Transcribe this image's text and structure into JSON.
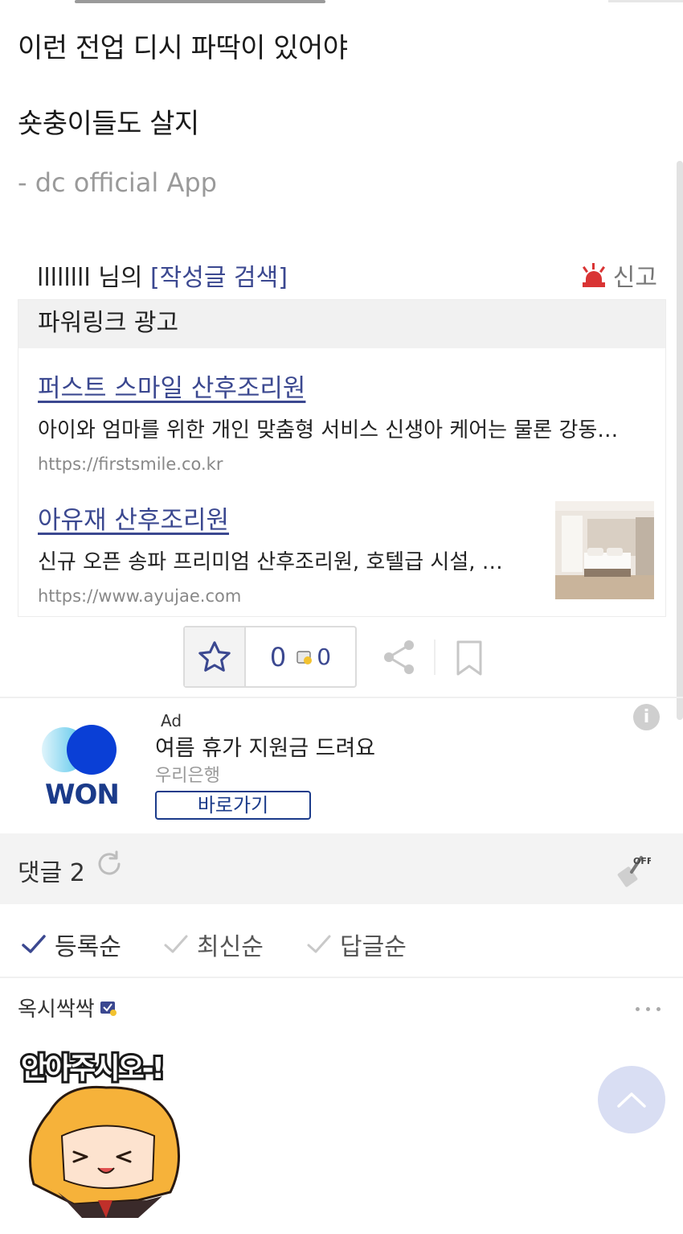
{
  "post": {
    "line1": "이런 전업 디시 파딱이 있어야",
    "line2": "숏충이들도 살지",
    "signature": "- dc official App"
  },
  "author": {
    "nickname": "llllllll 님의",
    "search_link": "[작성글 검색]",
    "report_label": "신고"
  },
  "powerlink": {
    "header": "파워링크 광고",
    "ads": [
      {
        "title": "퍼스트 스마일 산후조리원",
        "desc": "아이와 엄마를 위한 개인 맞춤형 서비스 신생아 케어는 물론 강동…",
        "url": "https://firstsmile.co.kr"
      },
      {
        "title": "아유재 산후조리원",
        "desc": "신규 오픈 송파 프리미엄 산후조리원, 호텔급 시설, …",
        "url": "https://www.ayujae.com"
      }
    ]
  },
  "actions": {
    "recommend_count": "0",
    "fixed_recommend_count": "0"
  },
  "bank_ad": {
    "logo_text": "WON",
    "ad_label": "Ad",
    "title": "여름 휴가 지원금 드려요",
    "advertiser": "우리은행",
    "button": "바로가기",
    "info_icon": "i"
  },
  "comments": {
    "header": "댓글 2",
    "sort": [
      {
        "label": "등록순",
        "active": true
      },
      {
        "label": "최신순",
        "active": false
      },
      {
        "label": "답글순",
        "active": false
      }
    ],
    "items": [
      {
        "user": "옥시싹싹",
        "dccon_text": "안아주시오-!"
      }
    ]
  },
  "colors": {
    "link": "#3b4890",
    "accent_red": "#d93434",
    "bank_blue": "#1b3b8a"
  },
  "icons": [
    "star-icon",
    "share-icon",
    "bookmark-icon",
    "refresh-icon",
    "broom-off-icon",
    "check-icon",
    "info-icon",
    "chevron-up-icon",
    "siren-icon"
  ]
}
